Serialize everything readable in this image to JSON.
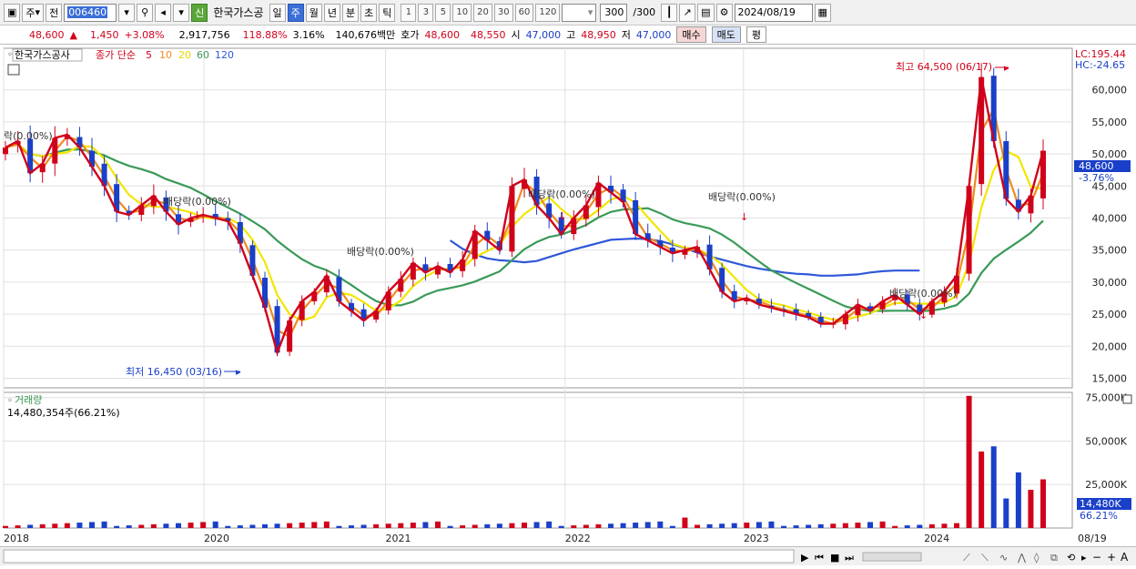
{
  "toolbar": {
    "period_label": "주",
    "dropdown_arrow": "▾",
    "prev_label": "전",
    "code": "006460",
    "stock_badge": "신",
    "stock_name": "한국가스공",
    "periods": [
      "일",
      "주",
      "월",
      "년",
      "분",
      "초",
      "틱"
    ],
    "selected_period": "주",
    "counts": [
      "1",
      "3",
      "5",
      "10",
      "20",
      "30",
      "60",
      "120"
    ],
    "page": "300",
    "page_total": "/300",
    "date": "2024/08/19"
  },
  "quote": {
    "price": "48,600",
    "arrow": "▲",
    "change": "1,450",
    "change_pct": "+3.08%",
    "volume": "2,917,756",
    "vol_ratio": "118.88%",
    "turnover": "3.16%",
    "amount": "140,676백만",
    "bid_label": "호가",
    "ask": "48,600",
    "bid": "48,550",
    "open_label": "시",
    "open": "47,000",
    "high_label": "고",
    "high": "48,950",
    "low_label": "저",
    "low": "47,000",
    "buy_label": "매수",
    "sell_label": "매도",
    "avg_label": "평"
  },
  "legend": {
    "name": "한국가스공사",
    "close": "종가 단순",
    "ma": [
      "5",
      "10",
      "20",
      "60",
      "120"
    ],
    "lc": "LC:195.44",
    "hc": "HC:-24.65"
  },
  "volume_panel": {
    "title": "거래량",
    "value": "14,480,354주(66.21%)",
    "badge": "14,480K",
    "badge_pct": "66.21%"
  },
  "annotations": {
    "high": "최고 64,500 (06/17)",
    "low": "최저 16,450 (03/16)",
    "div1": "락(0.00%)",
    "div2": "배당락(0.00%)",
    "div3": "배당락(0.00%)",
    "div4": "배당락(0.00%)",
    "div5": "배당락(0.00%)",
    "div6": "배당락(0.00%)"
  },
  "price_badge": {
    "value": "48,600",
    "pct": "-3.76%"
  },
  "colors": {
    "up": "#d0021b",
    "down": "#1a3fc8",
    "ma5": "#d0021b",
    "ma10": "#f08a1c",
    "ma20": "#f2e600",
    "ma60": "#3a9a57",
    "ma120": "#2f57d8",
    "grid": "#e0e0e0"
  },
  "chart_data": {
    "type": "candlestick",
    "x_ticks": [
      "2018",
      "2020",
      "2021",
      "2022",
      "2023",
      "2024",
      "08/19"
    ],
    "y_ticks": [
      "60,000",
      "55,000",
      "50,000",
      "45,000",
      "40,000",
      "35,000",
      "30,000",
      "25,000",
      "20,000",
      "15,000"
    ],
    "ylim": [
      13500,
      66500
    ],
    "vol_ticks": [
      "75,000K",
      "50,000K",
      "25,000K"
    ],
    "vol_ylim": [
      0,
      78000
    ],
    "close": [
      51000,
      52000,
      47000,
      48500,
      52500,
      53000,
      51000,
      48000,
      45000,
      41000,
      40500,
      42000,
      43500,
      41000,
      39000,
      40000,
      40500,
      40000,
      39500,
      36000,
      31000,
      26000,
      19000,
      24000,
      27000,
      28500,
      31000,
      27000,
      25500,
      24000,
      25500,
      28500,
      30500,
      33000,
      31500,
      32500,
      31500,
      33500,
      38000,
      36500,
      35000,
      45000,
      46000,
      42000,
      40000,
      37500,
      40000,
      42000,
      45500,
      44000,
      42500,
      37500,
      36500,
      35500,
      34500,
      35000,
      35500,
      32000,
      28500,
      27000,
      27500,
      26500,
      26000,
      25500,
      25000,
      24500,
      23500,
      23500,
      25000,
      26500,
      25500,
      27000,
      28000,
      26500,
      25000,
      27000,
      28500,
      31000,
      45000,
      62000,
      52000,
      43000,
      41000,
      43500,
      50500
    ],
    "ma120": [
      null,
      null,
      null,
      null,
      null,
      null,
      null,
      null,
      null,
      null,
      null,
      null,
      null,
      null,
      null,
      null,
      null,
      null,
      null,
      null,
      null,
      null,
      null,
      null,
      null,
      null,
      null,
      null,
      null,
      null,
      null,
      null,
      null,
      null,
      null,
      null,
      36500,
      35200,
      34300,
      33700,
      33400,
      33300,
      33100,
      33300,
      33900,
      34500,
      35100,
      35600,
      36100,
      36600,
      36700,
      36800,
      36700,
      36400,
      35900,
      35300,
      34600,
      34000,
      33500,
      33000,
      32500,
      32100,
      31800,
      31500,
      31300,
      31200,
      31000,
      31000,
      31100,
      31200,
      31500,
      31700,
      31800,
      31800,
      31800
    ]
  }
}
